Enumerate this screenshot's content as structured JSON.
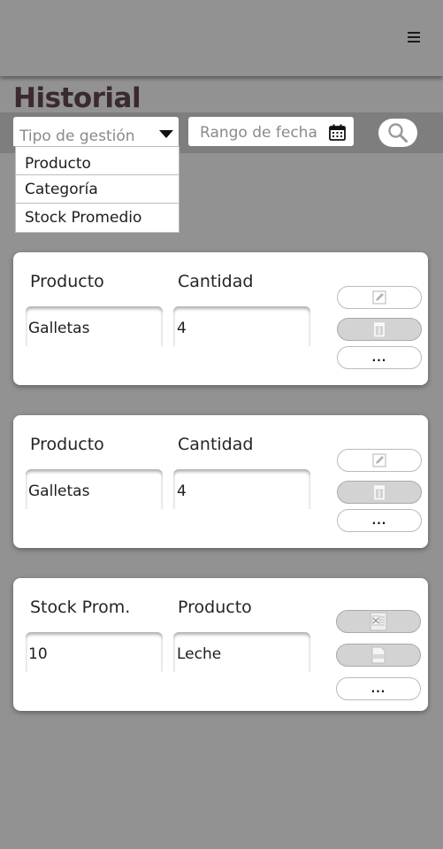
{
  "header": {
    "menu_icon": "hamburger-menu-icon"
  },
  "page": {
    "title": "Historial"
  },
  "filters": {
    "type_select": {
      "placeholder": "Tipo de gestión",
      "icon": "caret-down-icon"
    },
    "type_options": [
      "Producto",
      "Categoría",
      "Stock Promedio"
    ],
    "date_range": {
      "placeholder": "Rango de fecha",
      "icon": "calendar-icon"
    },
    "search": {
      "icon": "search-icon"
    }
  },
  "cards": [
    {
      "label1": "Producto",
      "label2": "Cantidad",
      "value1": "Galletas",
      "value2": "4",
      "actions": [
        "edit-icon",
        "trash-icon",
        "more-icon"
      ]
    },
    {
      "label1": "Producto",
      "label2": "Cantidad",
      "value1": "Galletas",
      "value2": "4",
      "actions": [
        "edit-icon",
        "trash-icon",
        "more-icon"
      ]
    },
    {
      "label1": "Stock Prom.",
      "label2": "Producto",
      "value1": "10",
      "value2": "Leche",
      "actions": [
        "excel-icon",
        "pdf-icon",
        "more-icon"
      ]
    }
  ],
  "more_label": "..."
}
